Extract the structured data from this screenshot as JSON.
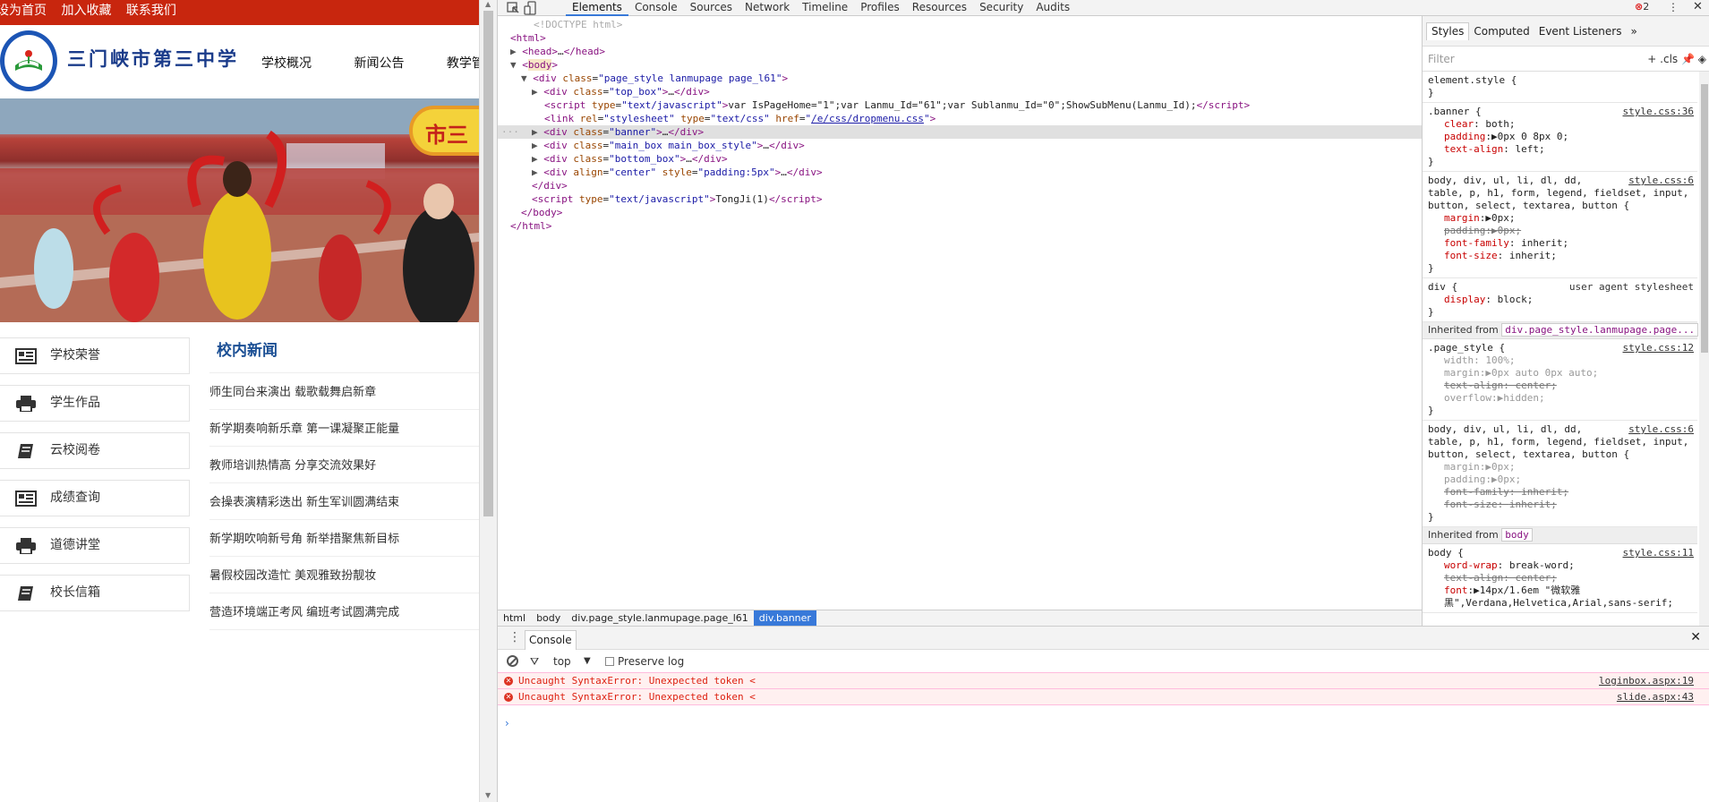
{
  "site": {
    "topbar": [
      "设为首页",
      "加入收藏",
      "联系我们"
    ],
    "school_name": "三门峡市第三中学",
    "nav": [
      "学校概况",
      "新闻公告",
      "教学管理"
    ],
    "banner_badge": "市三",
    "side_menu": [
      {
        "label": "学校荣誉",
        "icon": "newspaper-icon"
      },
      {
        "label": "学生作品",
        "icon": "printer-icon"
      },
      {
        "label": "云校阅卷",
        "icon": "book-icon"
      },
      {
        "label": "成绩查询",
        "icon": "newspaper-icon"
      },
      {
        "label": "道德讲堂",
        "icon": "printer-icon"
      },
      {
        "label": "校长信箱",
        "icon": "book-icon"
      }
    ],
    "news_title": "校内新闻",
    "news": [
      "师生同台来演出 载歌载舞启新章",
      "新学期奏响新乐章 第一课凝聚正能量",
      "教师培训热情高 分享交流效果好",
      "会操表演精彩迭出 新生军训圆满结束",
      "新学期吹响新号角 新举措聚焦新目标",
      "暑假校园改造忙 美观雅致扮靓妆",
      "营造环境端正考风 编班考试圆满完成"
    ]
  },
  "devtools": {
    "tabs": [
      "Elements",
      "Console",
      "Sources",
      "Network",
      "Timeline",
      "Profiles",
      "Resources",
      "Security",
      "Audits"
    ],
    "active_tab": "Elements",
    "error_count": "2",
    "dom": {
      "doctype": "<!DOCTYPE html>",
      "html_open": "<html>",
      "head": "head",
      "body": "body",
      "page_div_class": "page_style lanmupage page_l61",
      "top_box_class": "top_box",
      "script_type": "text/javascript",
      "script_text": "var IsPageHome=\"1\";var Lanmu_Id=\"61\";var Sublanmu_Id=\"0\";ShowSubMenu(Lanmu_Id);",
      "link_rel": "stylesheet",
      "link_type": "text/css",
      "link_href": "/e/css/dropmenu.css",
      "banner_class": "banner",
      "main_box_class": "main_box main_box_style",
      "bottom_box_class": "bottom_box",
      "div_align": "center",
      "div_style": "padding:5px",
      "tongji_text": "TongJi(1)"
    },
    "breadcrumbs": [
      "html",
      "body",
      "div.page_style.lanmupage.page_l61",
      "div.banner"
    ],
    "styles_tabs": [
      "Styles",
      "Computed",
      "Event Listeners"
    ],
    "filter_placeholder": "Filter",
    "filter_tools": "+ .cls",
    "rules": {
      "element_style": "element.style {",
      "banner_selector": ".banner {",
      "banner_src": "style.css:36",
      "banner_props": [
        [
          "clear",
          "both;"
        ],
        [
          "padding",
          "0px 0 8px 0;"
        ],
        [
          "text-align",
          "left;"
        ]
      ],
      "reset_selector": "body, div, ul, li, dl, dd,\ntable, p, h1, form, legend, fieldset, input,\nbutton, select, textarea, button {",
      "reset_src": "style.css:6",
      "reset_props": [
        [
          "margin",
          "0px;"
        ],
        [
          "padding",
          "0px;"
        ],
        [
          "font-family",
          "inherit;"
        ],
        [
          "font-size",
          "inherit;"
        ]
      ],
      "div_selector": "div {",
      "div_src": "user agent stylesheet",
      "div_props": [
        [
          "display",
          "block;"
        ]
      ],
      "inherited_label": "Inherited from",
      "inherited_from_1": "div.page_style.lanmupage.page...",
      "page_selector": ".page_style {",
      "page_src": "style.css:12",
      "page_props": [
        [
          "width",
          "100%;"
        ],
        [
          "margin",
          "0px auto 0px auto;"
        ],
        [
          "text-align",
          "center;"
        ],
        [
          "overflow",
          "hidden;"
        ]
      ],
      "reset2_src": "style.css:6",
      "reset2_props": [
        [
          "margin",
          "0px;"
        ],
        [
          "padding",
          "0px;"
        ],
        [
          "font-family",
          "inherit;"
        ],
        [
          "font-size",
          "inherit;"
        ]
      ],
      "inherited_from_2": "body",
      "body_selector": "body {",
      "body_src": "style.css:11",
      "body_props": [
        [
          "word-wrap",
          "break-word;"
        ],
        [
          "text-align",
          "center;"
        ],
        [
          "font",
          "14px/1.6em \"微软雅黑\",Verdana,Helvetica,Arial,sans-serif;"
        ]
      ]
    },
    "console": {
      "tab": "Console",
      "context": "top",
      "preserve_log": "Preserve log",
      "errors": [
        {
          "msg": "Uncaught SyntaxError: Unexpected token <",
          "loc": "loginbox.aspx:19"
        },
        {
          "msg": "Uncaught SyntaxError: Unexpected token <",
          "loc": "slide.aspx:43"
        }
      ],
      "prompt": "›"
    }
  }
}
